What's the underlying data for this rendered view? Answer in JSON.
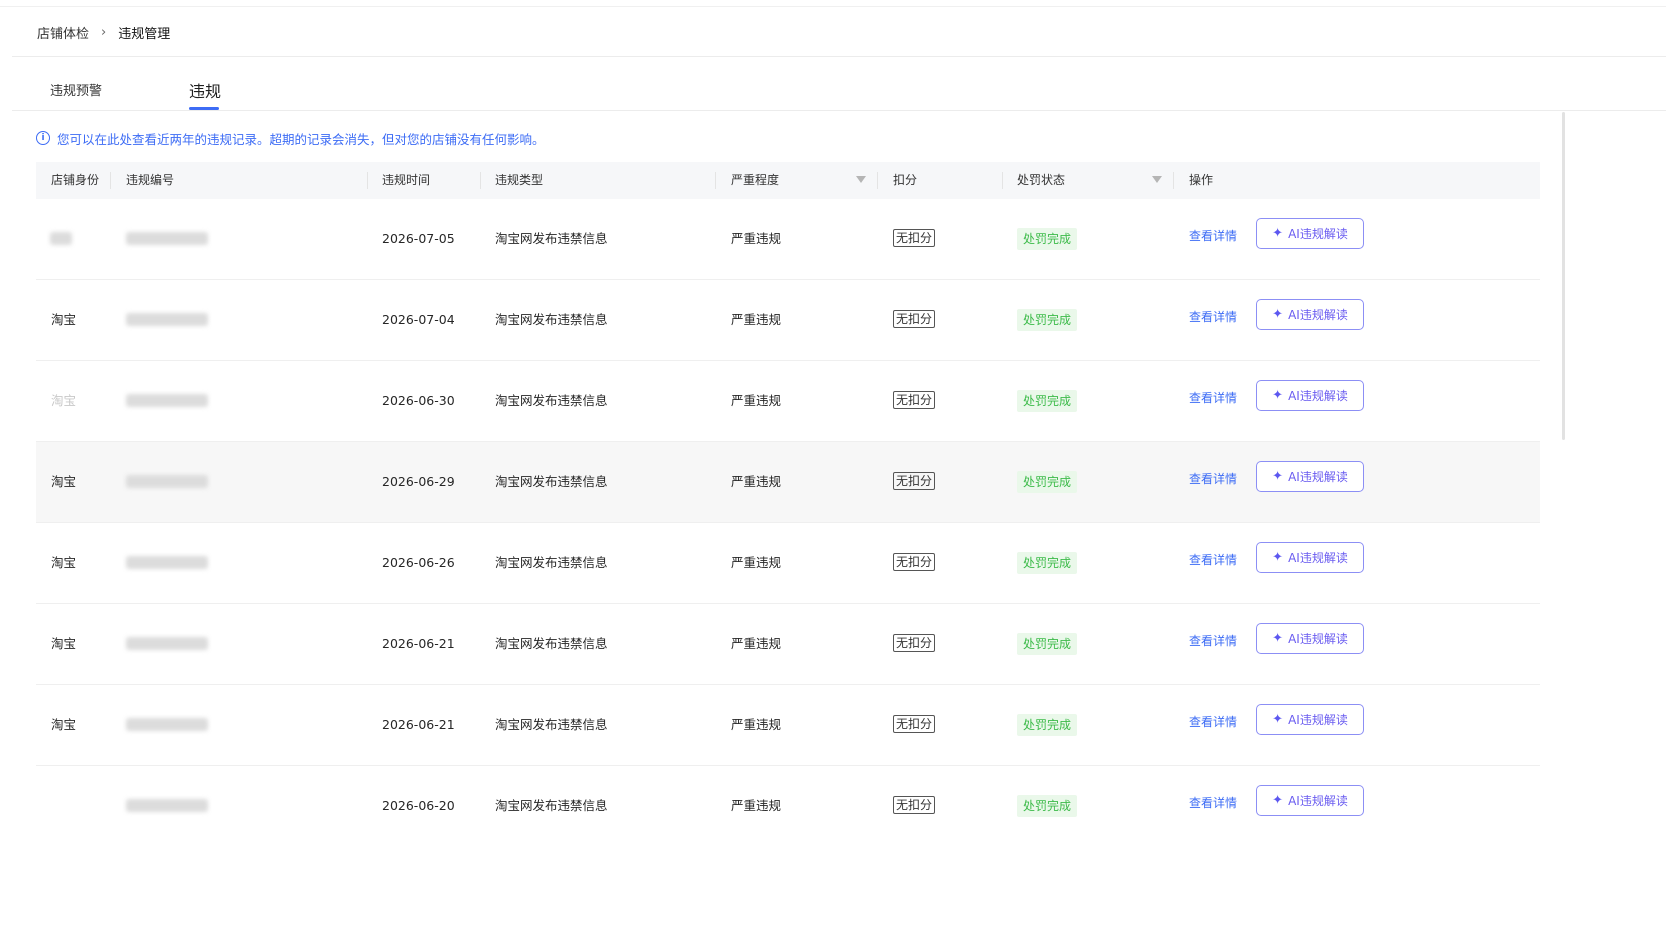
{
  "breadcrumb": {
    "parent": "店铺体检",
    "separator": "›",
    "current": "违规管理"
  },
  "tabs": [
    {
      "label": "违规预警",
      "active": false
    },
    {
      "label": "违规",
      "active": true
    }
  ],
  "notice": {
    "icon": "info-icon",
    "text": "您可以在此处查看近两年的违规记录。超期的记录会消失，但对您的店铺没有任何影响。"
  },
  "table": {
    "columns": [
      {
        "label": "店铺身份"
      },
      {
        "label": "违规编号"
      },
      {
        "label": "违规时间"
      },
      {
        "label": "违规类型"
      },
      {
        "label": "严重程度",
        "filter": true
      },
      {
        "label": "扣分"
      },
      {
        "label": "处罚状态",
        "filter": true
      },
      {
        "label": "操作"
      }
    ],
    "rows": [
      {
        "identity": "",
        "id": "",
        "time": "2026-07-05",
        "type": "淘宝网发布违禁信息",
        "severity": "严重违规",
        "deduct": "无扣分",
        "status": "处罚完成",
        "detail": "查看详情",
        "ai": "AI违规解读"
      },
      {
        "identity": "淘宝",
        "id": "",
        "time": "2026-07-04",
        "type": "淘宝网发布违禁信息",
        "severity": "严重违规",
        "deduct": "无扣分",
        "status": "处罚完成",
        "detail": "查看详情",
        "ai": "AI违规解读"
      },
      {
        "identity": "淘宝",
        "id": "",
        "time": "2026-06-30",
        "type": "淘宝网发布违禁信息",
        "severity": "严重违规",
        "deduct": "无扣分",
        "status": "处罚完成",
        "detail": "查看详情",
        "ai": "AI违规解读"
      },
      {
        "identity": "淘宝",
        "id": "",
        "time": "2026-06-29",
        "type": "淘宝网发布违禁信息",
        "severity": "严重违规",
        "deduct": "无扣分",
        "status": "处罚完成",
        "detail": "查看详情",
        "ai": "AI违规解读"
      },
      {
        "identity": "淘宝",
        "id": "",
        "time": "2026-06-26",
        "type": "淘宝网发布违禁信息",
        "severity": "严重违规",
        "deduct": "无扣分",
        "status": "处罚完成",
        "detail": "查看详情",
        "ai": "AI违规解读"
      },
      {
        "identity": "淘宝",
        "id": "",
        "time": "2026-06-21",
        "type": "淘宝网发布违禁信息",
        "severity": "严重违规",
        "deduct": "无扣分",
        "status": "处罚完成",
        "detail": "查看详情",
        "ai": "AI违规解读"
      },
      {
        "identity": "淘宝",
        "id": "",
        "time": "2026-06-21",
        "type": "淘宝网发布违禁信息",
        "severity": "严重违规",
        "deduct": "无扣分",
        "status": "处罚完成",
        "detail": "查看详情",
        "ai": "AI违规解读"
      },
      {
        "identity": "",
        "id": "",
        "time": "2026-06-20",
        "type": "淘宝网发布违禁信息",
        "severity": "严重违规",
        "deduct": "无扣分",
        "status": "处罚完成",
        "detail": "查看详情",
        "ai": "AI违规解读"
      }
    ]
  },
  "colors": {
    "accent": "#3d6cf5",
    "status_text": "#3dbb4a",
    "status_bg": "#eaf8ea",
    "ai_border": "#8c8ff5",
    "ai_text": "#6a5cf0"
  }
}
